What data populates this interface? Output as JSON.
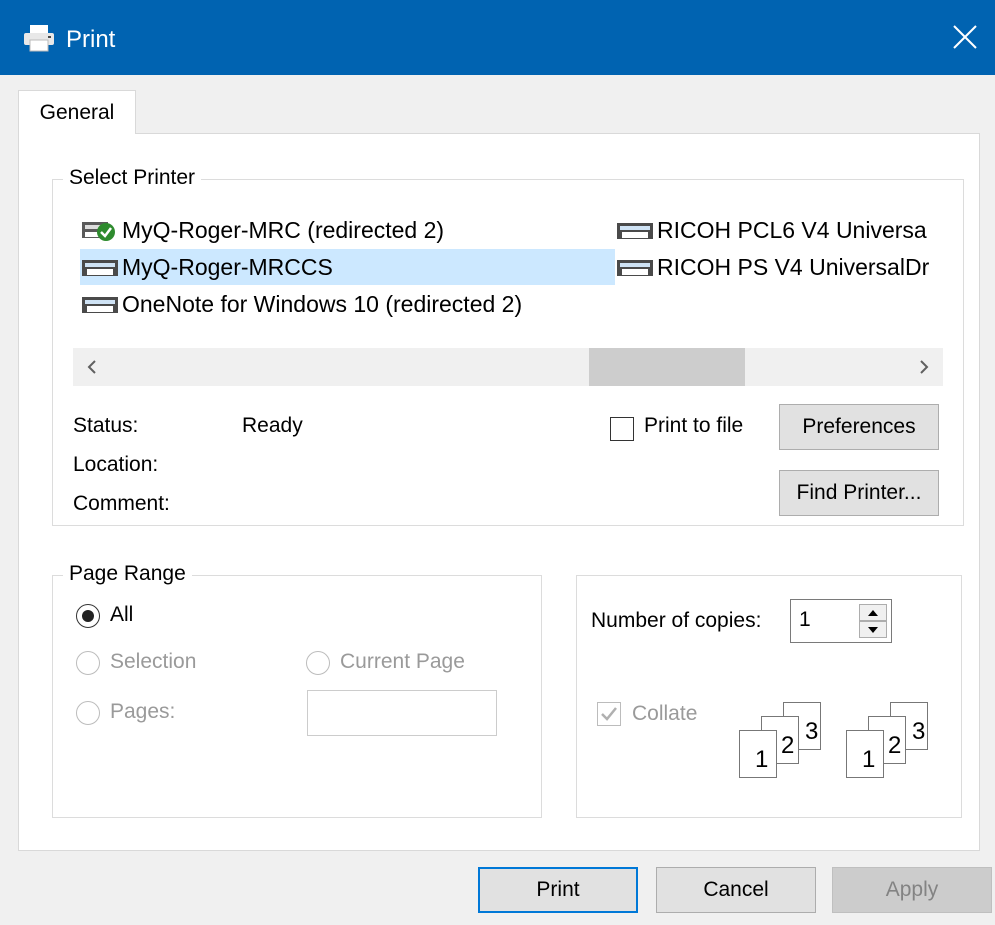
{
  "window": {
    "title": "Print",
    "icon": "printer-icon",
    "close_icon": "close-icon"
  },
  "tabs": [
    {
      "label": "General",
      "active": true
    }
  ],
  "select_printer": {
    "legend": "Select Printer",
    "printers": [
      {
        "name": "MyQ-Roger-MRC (redirected 2)",
        "icon": "printer-default-icon",
        "selected": false
      },
      {
        "name": "MyQ-Roger-MRCCS",
        "icon": "printer-icon",
        "selected": true
      },
      {
        "name": "OneNote for Windows 10 (redirected 2)",
        "icon": "printer-icon",
        "selected": false
      },
      {
        "name": "RICOH PCL6 V4 Universa",
        "icon": "printer-icon",
        "selected": false
      },
      {
        "name": "RICOH PS V4 UniversalDr",
        "icon": "printer-icon",
        "selected": false
      }
    ],
    "status_label": "Status:",
    "status_value": "Ready",
    "location_label": "Location:",
    "comment_label": "Comment:",
    "print_to_file_label": "Print to file",
    "preferences_label": "Preferences",
    "find_printer_label": "Find Printer..."
  },
  "page_range": {
    "legend": "Page Range",
    "all_label": "All",
    "selection_label": "Selection",
    "current_page_label": "Current Page",
    "pages_label": "Pages:",
    "pages_value": ""
  },
  "copies": {
    "label": "Number of copies:",
    "value": "1",
    "collate_label": "Collate",
    "collate_checked": true,
    "collate_pages": [
      "1",
      "2",
      "3"
    ]
  },
  "footer": {
    "print_label": "Print",
    "cancel_label": "Cancel",
    "apply_label": "Apply"
  },
  "colors": {
    "titlebar": "#0063b1",
    "selection": "#cce8ff",
    "default_button_border": "#0078d7"
  }
}
